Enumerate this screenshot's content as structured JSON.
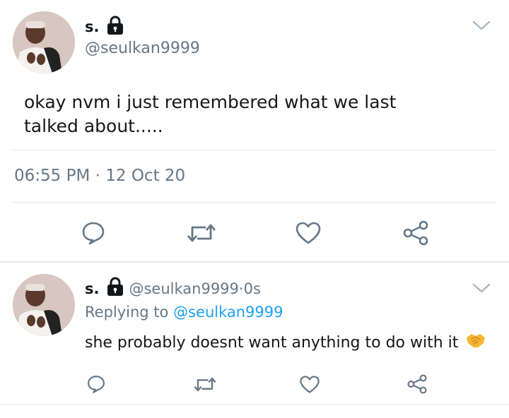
{
  "main_tweet": {
    "display_name": "s.",
    "handle": "@seulkan9999",
    "text": "okay nvm i just remembered what we last\ntalked about.....",
    "time": "06:55 PM",
    "separator": " · ",
    "date": "12 Oct 20",
    "icons": [
      "lock-icon",
      "chevron-down-icon",
      "reply-icon",
      "retweet-icon",
      "like-icon",
      "share-icon"
    ]
  },
  "reply_tweet": {
    "display_name": "s.",
    "handle": "@seulkan9999",
    "separator": " · ",
    "age": "0s",
    "replying_prefix": "Replying to ",
    "replying_to": "@seulkan9999",
    "text": "she probably doesnt want anything to do with it",
    "icons": [
      "lock-icon",
      "chevron-down-icon",
      "handshake-emoji-icon",
      "reply-icon",
      "retweet-icon",
      "like-icon",
      "share-icon"
    ]
  },
  "colors": {
    "text": "#14171a",
    "muted": "#657786",
    "link": "#1da1f2",
    "divider": "#e1e8ed",
    "icon": "#657786"
  }
}
